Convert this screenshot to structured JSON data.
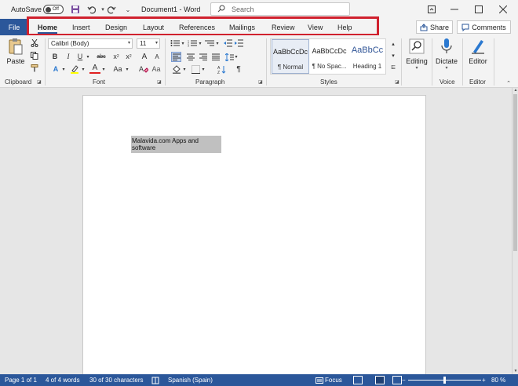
{
  "titlebar": {
    "autosave_label": "AutoSave",
    "autosave_state": "Off",
    "document_title": "Document1",
    "separator": "-",
    "app_name": "Word",
    "search_placeholder": "Search"
  },
  "tabs": {
    "file": "File",
    "items": [
      "Home",
      "Insert",
      "Design",
      "Layout",
      "References",
      "Mailings",
      "Review",
      "View",
      "Help"
    ],
    "active": "Home"
  },
  "actions": {
    "share": "Share",
    "comments": "Comments"
  },
  "ribbon": {
    "clipboard": {
      "label": "Clipboard",
      "paste": "Paste"
    },
    "font": {
      "label": "Font",
      "font_name": "Calibri (Body)",
      "font_size": "11",
      "bold": "B",
      "italic": "I",
      "underline": "U",
      "strike": "abc",
      "grow": "A",
      "shrink": "A",
      "case": "Aa",
      "font_color": "A",
      "effects": "A"
    },
    "paragraph": {
      "label": "Paragraph"
    },
    "styles": {
      "label": "Styles",
      "items": [
        {
          "sample": "AaBbCcDc",
          "name": "¶ Normal"
        },
        {
          "sample": "AaBbCcDc",
          "name": "¶ No Spac..."
        },
        {
          "sample": "AaBbCc",
          "name": "Heading 1"
        }
      ]
    },
    "editing": {
      "label": "Editing"
    },
    "voice": {
      "label": "Voice",
      "dictate": "Dictate"
    },
    "editor": {
      "label": "Editor",
      "editor_btn": "Editor"
    }
  },
  "document": {
    "text": "Malavida.com Apps and software"
  },
  "statusbar": {
    "page": "Page 1 of 1",
    "words": "4 of 4 words",
    "characters": "30 of 30 characters",
    "language": "Spanish (Spain)",
    "focus": "Focus",
    "zoom": "80 %",
    "zoom_minus": "−",
    "zoom_plus": "+"
  },
  "colors": {
    "accent": "#2b579a",
    "highlight_box": "#d0212e",
    "font_color_bar": "#e02020",
    "highlight_bar": "#ffff00"
  }
}
